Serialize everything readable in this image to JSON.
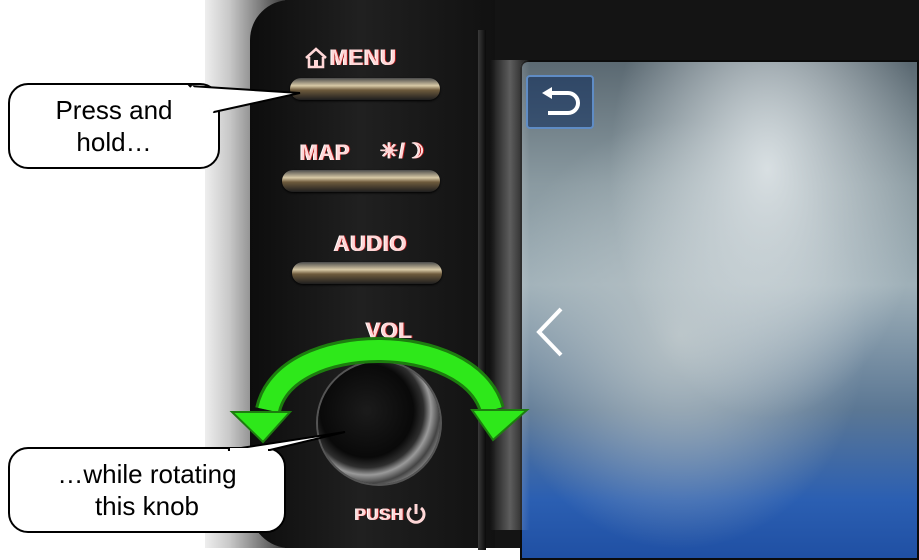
{
  "hardware_buttons": {
    "menu_label": "MENU",
    "map_label": "MAP",
    "daynight_label": "☀/☽",
    "audio_label": "AUDIO",
    "vol_label": "VOL",
    "push_label": "PUSH"
  },
  "callouts": {
    "press_hold_line1": "Press and",
    "press_hold_line2": "hold…",
    "rotate_line1": "…while rotating",
    "rotate_line2": "this knob"
  },
  "icons": {
    "home": "home-icon",
    "back": "back-arrow-icon",
    "chevron": "chevron-left-icon",
    "power": "power-icon",
    "rotate_arrow": "rotate-arrow-icon"
  },
  "colors": {
    "label_red": "#b01818",
    "arrow_green": "#2ee81a",
    "screen_blue": "#2b5fb2",
    "back_border": "#5f8cc5"
  }
}
